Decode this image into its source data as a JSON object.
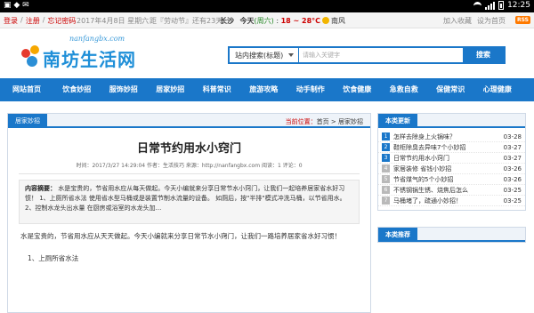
{
  "statusbar": {
    "time": "12:25"
  },
  "topbar": {
    "login": "登录",
    "register": "注册",
    "forgot": "忘记密码",
    "date": "2017年4月8日 星期六",
    "countdown": "距『劳动节』还有23天",
    "city": "长沙",
    "today_label": "今天",
    "weekday": "(周六)",
    "temp": "18 ~ 28",
    "temp_unit": "°C",
    "weather_suffix": "南风",
    "add_fav": "加入收藏",
    "set_home": "设为首页",
    "rss": "RSS"
  },
  "header": {
    "logo_domain": "nanfangbx.com",
    "logo_text": "南坊生活网"
  },
  "search": {
    "select_label": "站内搜索(标题)",
    "placeholder": "请输入关键字",
    "button": "搜索"
  },
  "nav": {
    "items": [
      "网站首页",
      "饮食妙招",
      "服饰妙招",
      "居家妙招",
      "科普常识",
      "旅游攻略",
      "动手制作",
      "饮食健康",
      "急救自救",
      "保健常识",
      "心理健康"
    ]
  },
  "main": {
    "category_tab": "居家妙招",
    "crumb_label": "当前位置：",
    "crumb_home": "首页",
    "crumb_sep": " > ",
    "crumb_cat": "居家妙招",
    "title": "日常节约用水小窍门",
    "meta": "时间：2017/3/27 14:29:04   作者：生活技巧   来源：http://nanfangbx.com   阅读：1   评论：0",
    "summary_label": "内容摘要：",
    "summary_text": "水是宝贵的，节省用水应从每天做起。今天小编就来分享日常节水小窍门，让我们一起培养居家省水好习惯！          1、上厕所省水法          使用省水型马桶或是装置节制水流量的设备。     如厕后，按\"半排\"模式冲洗马桶，以节省用水。          2、控制水龙头出水量          在厨房或浴室的水龙头加...",
    "body_paragraph": "水是宝贵的，节省用水应从天天做起。今天小编就来分享日常节水小窍门，让我们一路培养居家省水好习惯！",
    "body_item": "1、上厕所省水法"
  },
  "sidebar": {
    "recent_title": "本类更新",
    "recent": [
      {
        "num": "1",
        "title": "怎样去除身上火锅味？",
        "date": "03-28"
      },
      {
        "num": "2",
        "title": "鞋柜除臭去异味7个小妙招",
        "date": "03-27"
      },
      {
        "num": "3",
        "title": "日常节约用水小窍门",
        "date": "03-27"
      },
      {
        "num": "4",
        "title": "家居装修 省钱小妙招",
        "date": "03-26"
      },
      {
        "num": "5",
        "title": "节省煤气的5个小妙招",
        "date": "03-26"
      },
      {
        "num": "6",
        "title": "不锈钢锅生锈、烧焦后怎么",
        "date": "03-25"
      },
      {
        "num": "7",
        "title": "马桶堵了，疏通小妙招！",
        "date": "03-25"
      }
    ],
    "recommend_title": "本类推荐"
  }
}
